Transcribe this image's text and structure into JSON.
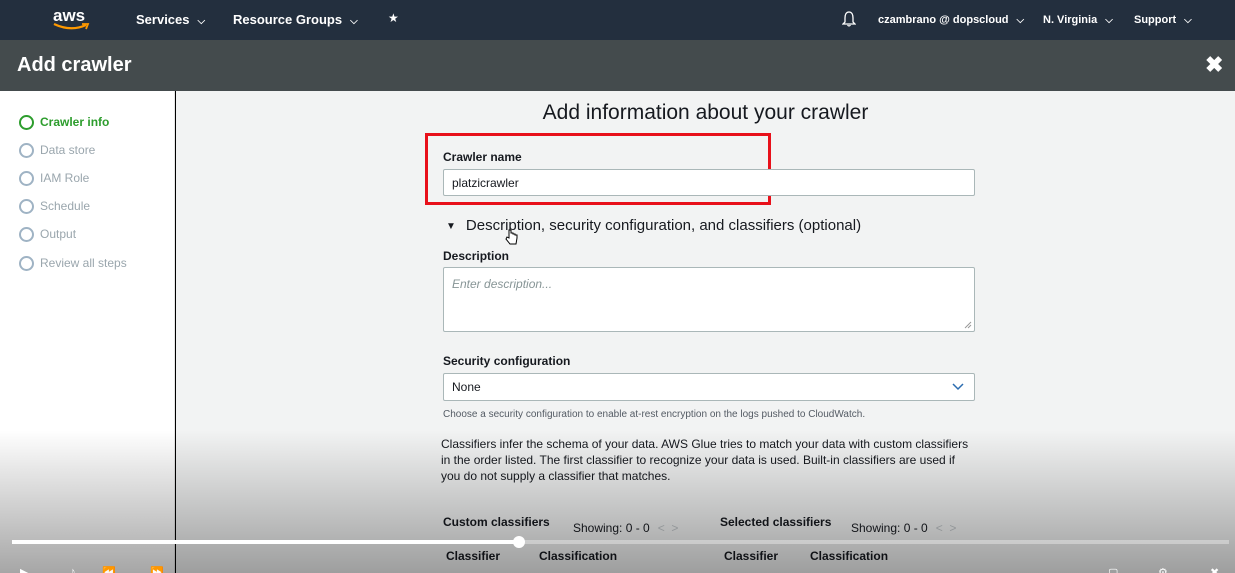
{
  "topnav": {
    "logo": "aws",
    "services": "Services",
    "resource_groups": "Resource Groups",
    "account": "czambrano @ dopscloud",
    "region": "N. Virginia",
    "support": "Support"
  },
  "titlebar": {
    "title": "Add crawler",
    "close_icon": "close-icon"
  },
  "sidebar": {
    "steps": [
      {
        "label": "Crawler info",
        "active": true
      },
      {
        "label": "Data store",
        "active": false
      },
      {
        "label": "IAM Role",
        "active": false
      },
      {
        "label": "Schedule",
        "active": false
      },
      {
        "label": "Output",
        "active": false
      },
      {
        "label": "Review all steps",
        "active": false
      }
    ]
  },
  "form": {
    "heading": "Add information about your crawler",
    "crawler_name_label": "Crawler name",
    "crawler_name_value": "platzicrawler",
    "optional_section": "Description, security configuration, and classifiers (optional)",
    "description_label": "Description",
    "description_placeholder": "Enter description...",
    "security_label": "Security configuration",
    "security_value": "None",
    "security_help": "Choose a security configuration to enable at-rest encryption on the logs pushed to CloudWatch.",
    "classifier_info": "Classifiers infer the schema of your data. AWS Glue tries to match your data with custom classifiers in the order listed. The first classifier to recognize your data is used. Built-in classifiers are used if you do not supply a classifier that matches.",
    "custom_classifiers": "Custom classifiers",
    "custom_showing": "Showing: 0 - 0",
    "selected_classifiers": "Selected classifiers",
    "selected_showing": "Showing: 0 - 0",
    "col_classifier": "Classifier",
    "col_classification": "Classification",
    "highlight_color": "#e8101a"
  },
  "video": {
    "progress": 0.417
  }
}
